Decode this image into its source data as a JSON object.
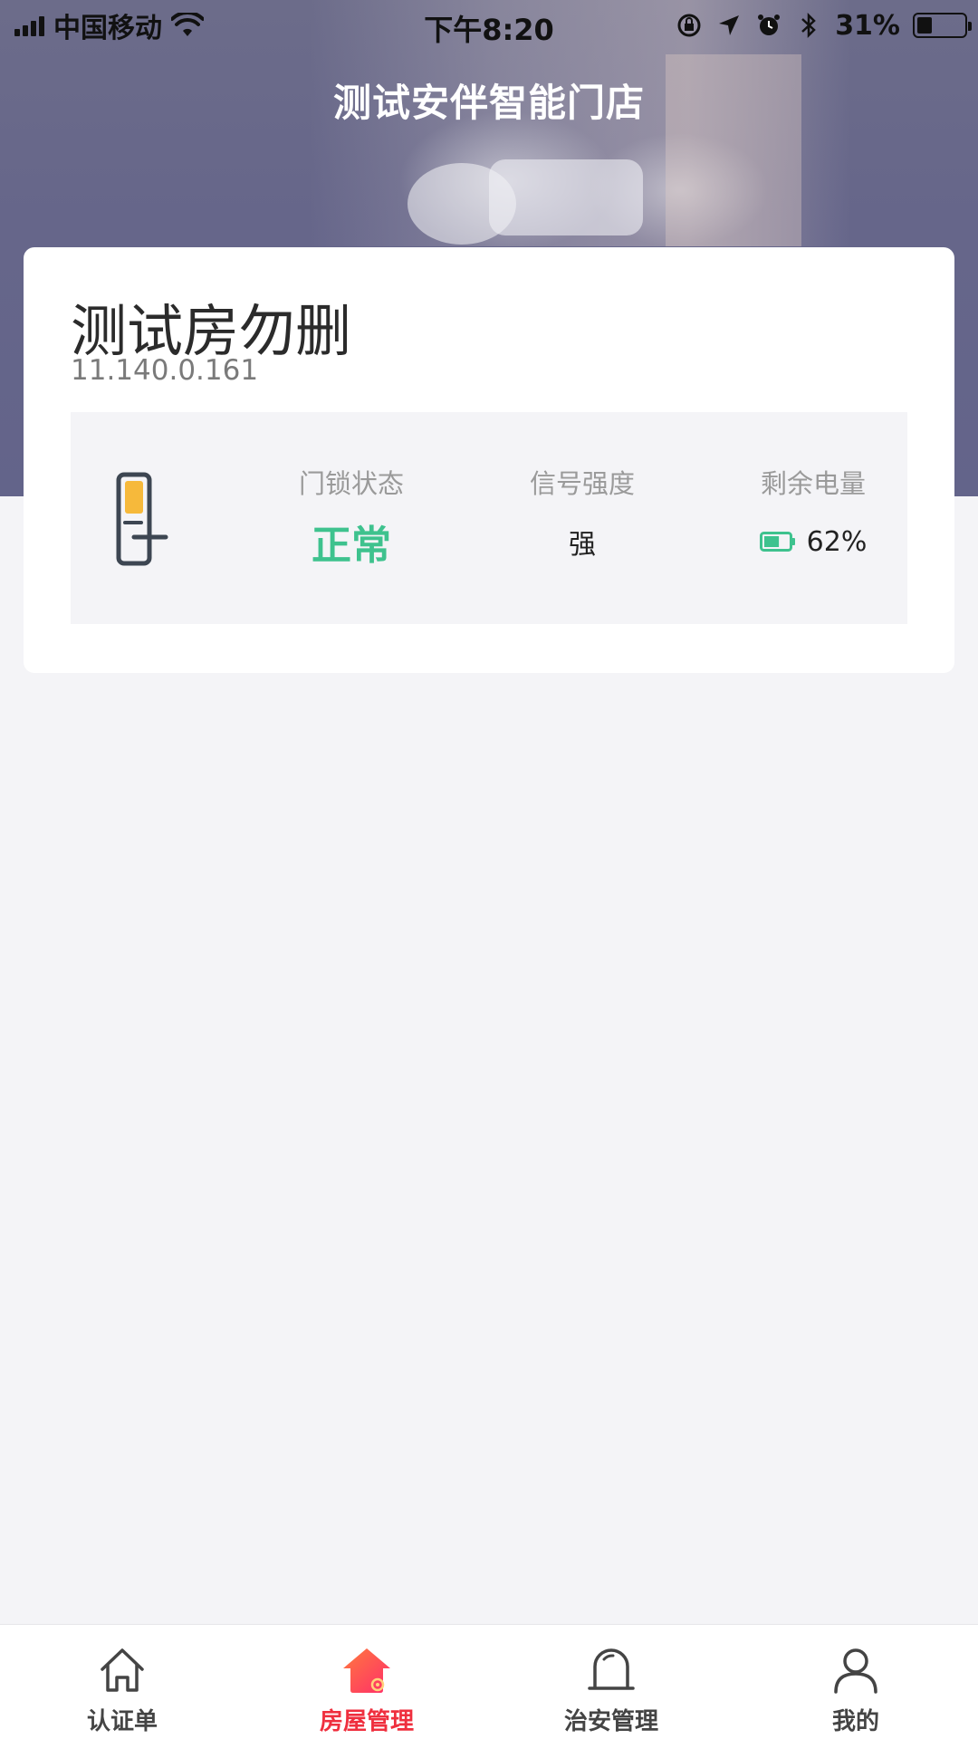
{
  "status_bar": {
    "carrier": "中国移动",
    "time": "下午8:20",
    "battery_percent": "31%",
    "battery_level": 0.31,
    "icons": [
      "signal-icon",
      "wifi-icon",
      "rotation-lock-icon",
      "location-icon",
      "alarm-icon",
      "bluetooth-icon",
      "battery-icon"
    ]
  },
  "header": {
    "title": "测试安伴智能门店"
  },
  "room_card": {
    "name": "测试房勿删",
    "ip": "11.140.0.161",
    "lock_icon": "door-lock-icon",
    "stats": [
      {
        "label": "门锁状态",
        "value": "正常"
      },
      {
        "label": "信号强度",
        "value": "强"
      },
      {
        "label": "剩余电量",
        "value": "62%",
        "level": 0.62,
        "icon": "battery-icon"
      }
    ]
  },
  "tabbar": {
    "active_index": 1,
    "tabs": [
      {
        "label": "认证单",
        "icon": "home-icon"
      },
      {
        "label": "房屋管理",
        "icon": "house-gear-icon"
      },
      {
        "label": "治安管理",
        "icon": "shield-arch-icon"
      },
      {
        "label": "我的",
        "icon": "user-icon"
      }
    ]
  },
  "colors": {
    "header_bg": "#66668a",
    "accent_green": "#3ec28e",
    "accent_red": "#ef2f3e",
    "lock_yellow": "#f6b93b",
    "page_bg": "#f4f4f7"
  }
}
